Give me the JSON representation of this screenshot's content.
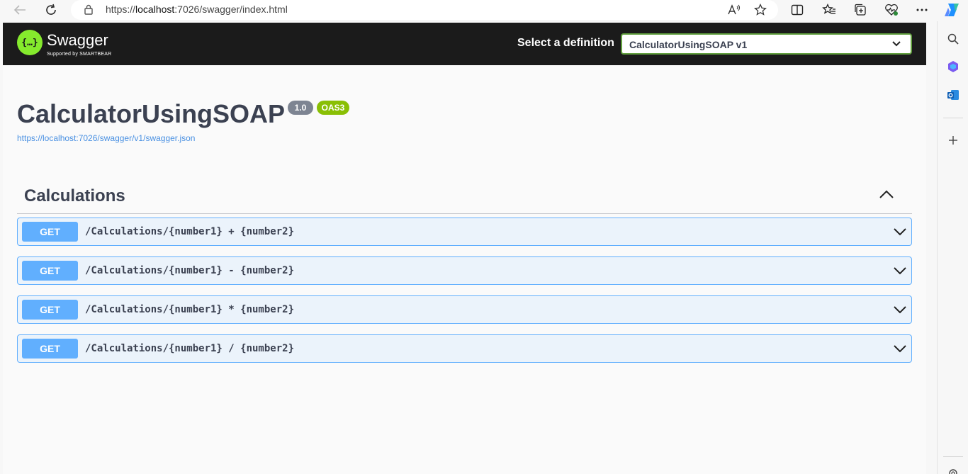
{
  "browser": {
    "url_prefix": "https://",
    "url_host": "localhost",
    "url_rest": ":7026/swagger/index.html"
  },
  "header": {
    "logo_name": "Swagger",
    "logo_sub": "Supported by SMARTBEAR",
    "logo_glyph": "{…}",
    "select_label": "Select a definition",
    "select_value": "CalculatorUsingSOAP v1"
  },
  "info": {
    "title": "CalculatorUsingSOAP",
    "version": "1.0",
    "oas": "OAS3",
    "spec_url": "https://localhost:7026/swagger/v1/swagger.json"
  },
  "tag": {
    "name": "Calculations"
  },
  "operations": [
    {
      "method": "GET",
      "path": "/Calculations/{number1} + {number2}"
    },
    {
      "method": "GET",
      "path": "/Calculations/{number1} - {number2}"
    },
    {
      "method": "GET",
      "path": "/Calculations/{number1} * {number2}"
    },
    {
      "method": "GET",
      "path": "/Calculations/{number1} / {number2}"
    }
  ],
  "colors": {
    "topbar": "#1b1b1b",
    "logo_green": "#85ea2d",
    "get_blue": "#61affe",
    "get_bg": "#ebf3fb",
    "badge_version": "#7d8492",
    "badge_oas": "#89bf04"
  }
}
